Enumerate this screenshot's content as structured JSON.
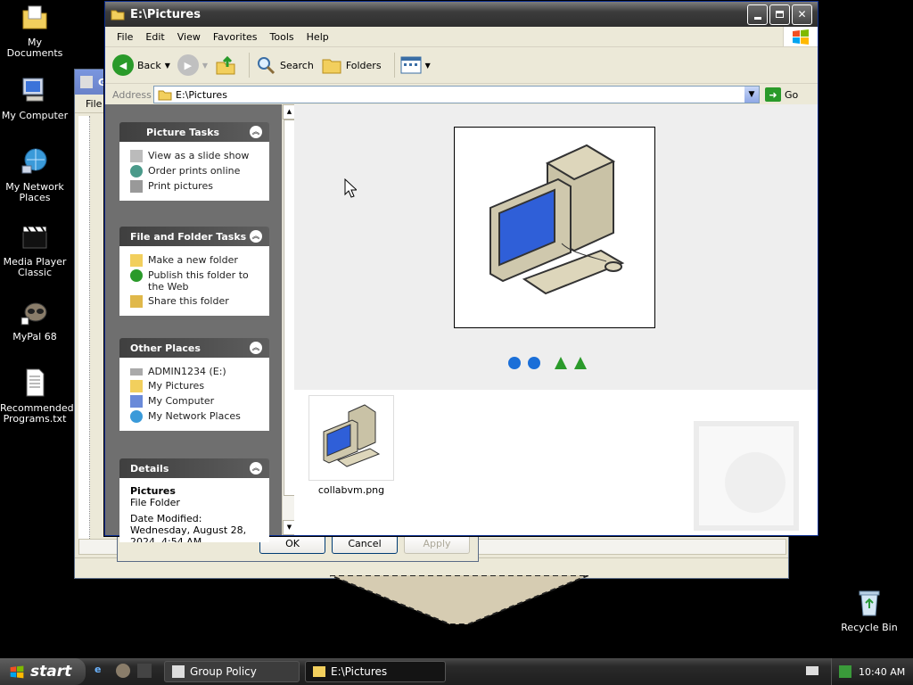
{
  "desktop": {
    "icons": [
      {
        "label": "My Documents"
      },
      {
        "label": "My Computer"
      },
      {
        "label": "My Network Places"
      },
      {
        "label": "Media Player Classic"
      },
      {
        "label": "MyPal 68"
      },
      {
        "label": "Recommended Programs.txt"
      },
      {
        "label": "Recycle Bin"
      }
    ]
  },
  "bg_window": {
    "title": "G",
    "menu_file": "File"
  },
  "bg_dialog": {
    "ok": "OK",
    "cancel": "Cancel",
    "apply": "Apply"
  },
  "explorer": {
    "title": "E:\\Pictures",
    "menu": [
      "File",
      "Edit",
      "View",
      "Favorites",
      "Tools",
      "Help"
    ],
    "toolbar": {
      "back": "Back",
      "search": "Search",
      "folders": "Folders"
    },
    "address": {
      "label": "Address",
      "value": "E:\\Pictures",
      "go": "Go"
    },
    "panels": {
      "picture_tasks": {
        "title": "Picture Tasks",
        "items": [
          "View as a slide show",
          "Order prints online",
          "Print pictures"
        ]
      },
      "file_folder_tasks": {
        "title": "File and Folder Tasks",
        "items": [
          "Make a new folder",
          "Publish this folder to the Web",
          "Share this folder"
        ]
      },
      "other_places": {
        "title": "Other Places",
        "items": [
          "ADMIN1234 (E:)",
          "My Pictures",
          "My Computer",
          "My Network Places"
        ]
      },
      "details": {
        "title": "Details",
        "name": "Pictures",
        "type": "File Folder",
        "modified": "Date Modified: Wednesday, August 28, 2024, 4:54 AM"
      }
    },
    "files": [
      {
        "name": "collabvm.png"
      }
    ]
  },
  "taskbar": {
    "start": "start",
    "tasks": [
      {
        "label": "Group Policy"
      },
      {
        "label": "E:\\Pictures"
      }
    ],
    "clock": "10:40 AM"
  },
  "colors": {
    "title_gray": "#3c3c3c",
    "panel_bg": "#6f6f6f",
    "link_blue": "#1b6fd8",
    "screen_blue": "#2f5fd8"
  }
}
